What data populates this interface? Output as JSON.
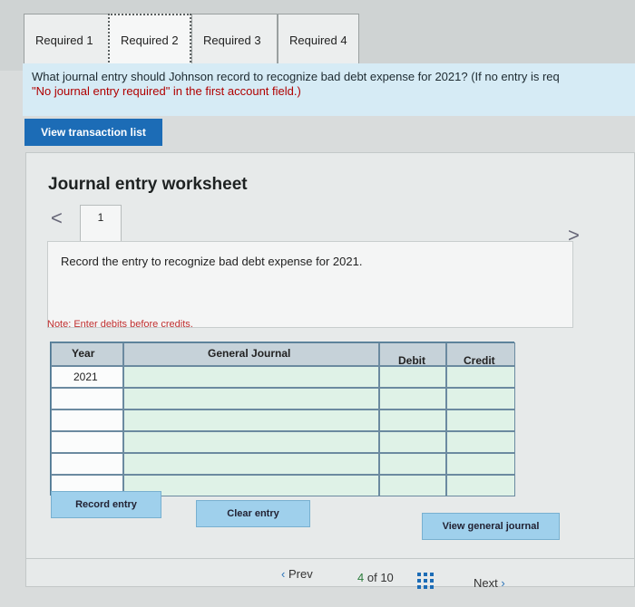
{
  "tabs": [
    {
      "label": "Required 1",
      "active": false
    },
    {
      "label": "Required 2",
      "active": true
    },
    {
      "label": "Required 3",
      "active": false
    },
    {
      "label": "Required 4",
      "active": false
    }
  ],
  "question": {
    "text": "What journal entry should Johnson record to recognize bad debt expense for 2021? (If no entry is req",
    "text2": "\"No journal entry required\" in the first account field.)"
  },
  "view_transaction_list": "View transaction list",
  "worksheet": {
    "title": "Journal entry worksheet",
    "prev_icon": "<",
    "next_icon": ">",
    "page": "1",
    "instruction": "Record the entry to recognize bad debt expense for 2021.",
    "note": "Note: Enter debits before credits."
  },
  "table": {
    "headers": {
      "year": "Year",
      "journal": "General Journal",
      "debit": "Debit",
      "credit": "Credit"
    },
    "rows": [
      {
        "year": "2021",
        "journal": "",
        "debit": "",
        "credit": ""
      },
      {
        "year": "",
        "journal": "",
        "debit": "",
        "credit": ""
      },
      {
        "year": "",
        "journal": "",
        "debit": "",
        "credit": ""
      },
      {
        "year": "",
        "journal": "",
        "debit": "",
        "credit": ""
      },
      {
        "year": "",
        "journal": "",
        "debit": "",
        "credit": ""
      },
      {
        "year": "",
        "journal": "",
        "debit": "",
        "credit": ""
      }
    ]
  },
  "buttons": {
    "record": "Record entry",
    "clear": "Clear entry",
    "view_general": "View general journal"
  },
  "pagination": {
    "prev": "Prev",
    "page_num": "4",
    "of": "of 10",
    "next": "Next"
  }
}
